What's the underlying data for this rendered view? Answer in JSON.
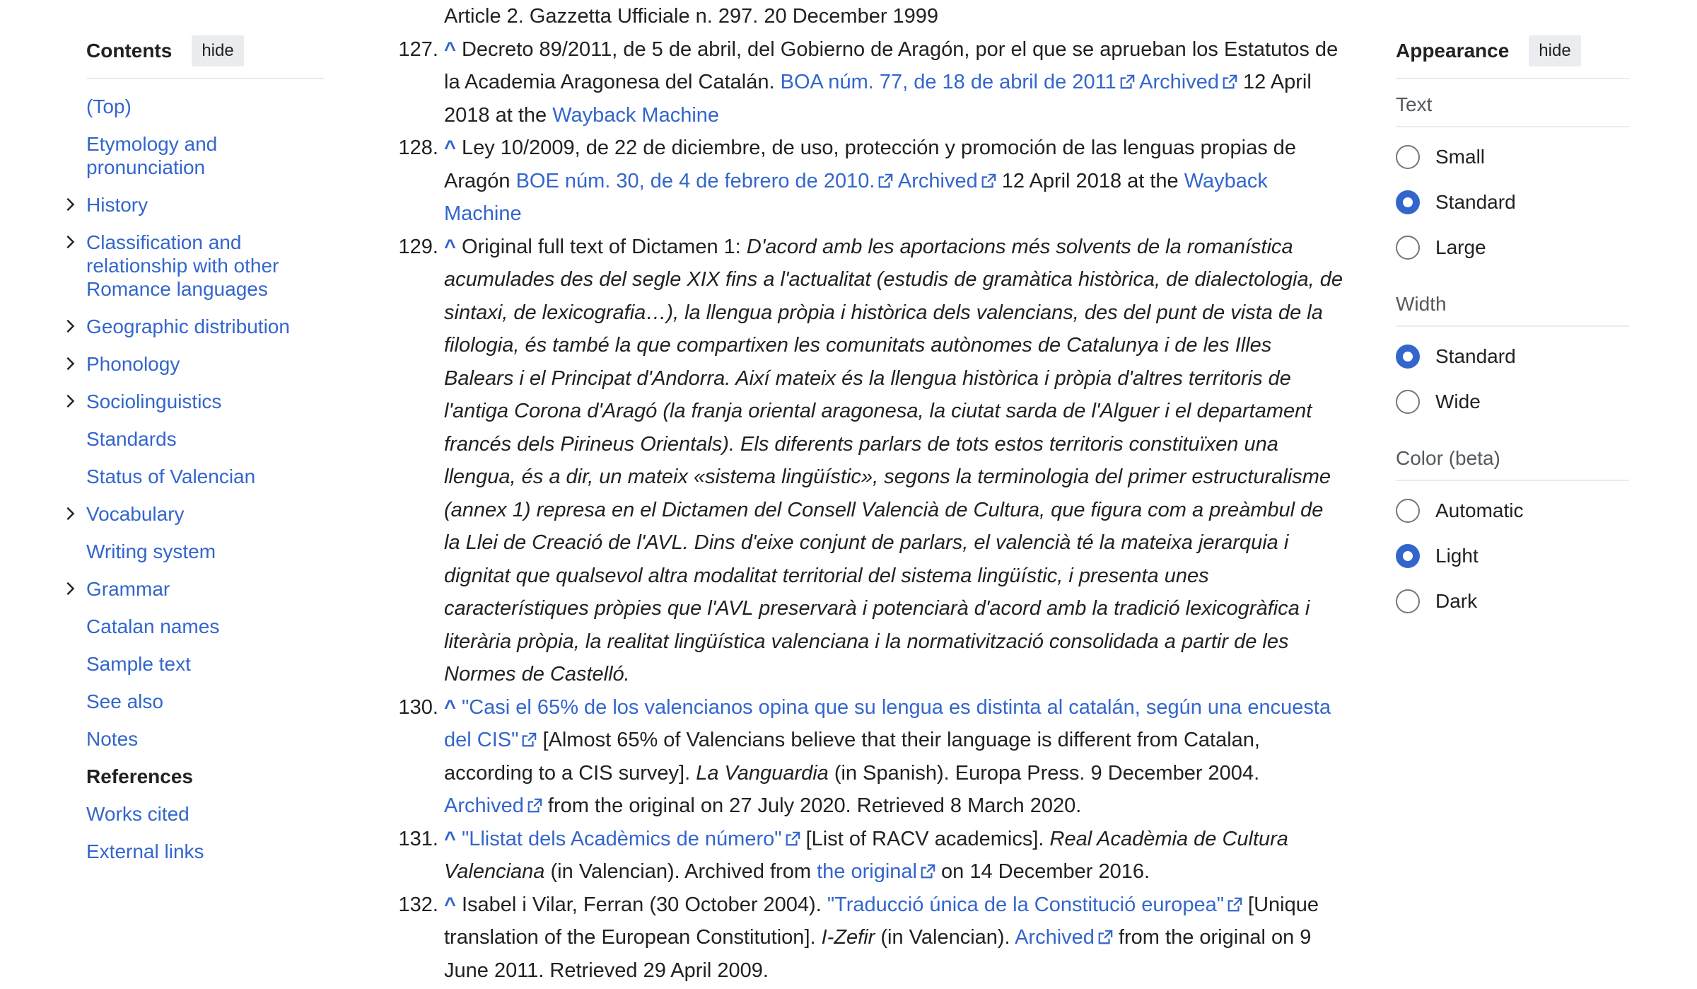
{
  "toc": {
    "title": "Contents",
    "hide_label": "hide",
    "items": [
      {
        "label": "(Top)",
        "expandable": false,
        "active": false
      },
      {
        "label": "Etymology and pronunciation",
        "expandable": false,
        "active": false
      },
      {
        "label": "History",
        "expandable": true,
        "active": false
      },
      {
        "label": "Classification and relationship with other Romance languages",
        "expandable": true,
        "active": false
      },
      {
        "label": "Geographic distribution",
        "expandable": true,
        "active": false
      },
      {
        "label": "Phonology",
        "expandable": true,
        "active": false
      },
      {
        "label": "Sociolinguistics",
        "expandable": true,
        "active": false
      },
      {
        "label": "Standards",
        "expandable": false,
        "active": false
      },
      {
        "label": "Status of Valencian",
        "expandable": false,
        "active": false
      },
      {
        "label": "Vocabulary",
        "expandable": true,
        "active": false
      },
      {
        "label": "Writing system",
        "expandable": false,
        "active": false
      },
      {
        "label": "Grammar",
        "expandable": true,
        "active": false
      },
      {
        "label": "Catalan names",
        "expandable": false,
        "active": false
      },
      {
        "label": "Sample text",
        "expandable": false,
        "active": false
      },
      {
        "label": "See also",
        "expandable": false,
        "active": false
      },
      {
        "label": "Notes",
        "expandable": false,
        "active": false
      },
      {
        "label": "References",
        "expandable": false,
        "active": true
      },
      {
        "label": "Works cited",
        "expandable": false,
        "active": false
      },
      {
        "label": "External links",
        "expandable": false,
        "active": false
      }
    ]
  },
  "references": {
    "top_fragment": "Article 2. Gazzetta Ufficiale n. 297. 20 December 1999",
    "r127": {
      "num": "127.",
      "caret": "^",
      "t1": "Decreto 89/2011, de 5 de abril, del Gobierno de Aragón, por el que se aprueban los Estatutos de la Academia Aragonesa del Catalán. ",
      "link1": "BOA núm. 77, de 18 de abril de 2011",
      "link2": "Archived",
      "t2": " 12 April 2018 at the ",
      "link3": "Wayback Machine"
    },
    "r128": {
      "num": "128.",
      "caret": "^",
      "t1": "Ley 10/2009, de 22 de diciembre, de uso, protección y promoción de las lenguas propias de Aragón ",
      "link1": "BOE núm. 30, de 4 de febrero de 2010.",
      "link2": "Archived",
      "t2": " 12 April 2018 at the ",
      "link3": "Wayback Machine"
    },
    "r129": {
      "num": "129.",
      "caret": "^",
      "t1": "Original full text of Dictamen 1: ",
      "italic": "D'acord amb les aportacions més solvents de la romanística acumulades des del segle XIX fins a l'actualitat (estudis de gramàtica històrica, de dialectologia, de sintaxi, de lexicografia…), la llengua pròpia i històrica dels valencians, des del punt de vista de la filologia, és també la que compartixen les comunitats autònomes de Catalunya i de les Illes Balears i el Principat d'Andorra. Així mateix és la llengua històrica i pròpia d'altres territoris de l'antiga Corona d'Aragó (la franja oriental aragonesa, la ciutat sarda de l'Alguer i el departament francés dels Pirineus Orientals). Els diferents parlars de tots estos territoris constituïxen una llengua, és a dir, un mateix «sistema lingüístic», segons la terminologia del primer estructuralisme (annex 1) represa en el Dictamen del Consell Valencià de Cultura, que figura com a preàmbul de la Llei de Creació de l'AVL. Dins d'eixe conjunt de parlars, el valencià té la mateixa jerarquia i dignitat que qualsevol altra modalitat territorial del sistema lingüístic, i presenta unes característiques pròpies que l'AVL preservarà i potenciarà d'acord amb la tradició lexicogràfica i literària pròpia, la realitat lingüística valenciana i la normativització consolidada a partir de les Normes de Castelló."
    },
    "r130": {
      "num": "130.",
      "caret": "^",
      "link1": "\"Casi el 65% de los valencianos opina que su lengua es distinta al catalán, según una encuesta del CIS\"",
      "t1": " [Almost 65% of Valencians believe that their language is different from Catalan, according to a CIS survey]. ",
      "italic": "La Vanguardia",
      "t2": " (in Spanish). Europa Press. 9 December 2004. ",
      "link2": "Archived",
      "t3": " from the original on 27 July 2020. Retrieved 8 March 2020."
    },
    "r131": {
      "num": "131.",
      "caret": "^",
      "link1": "\"Llistat dels Acadèmics de número\"",
      "t1": " [List of RACV academics]. ",
      "italic": "Real Acadèmia de Cultura Valenciana",
      "t2": " (in Valencian). Archived from ",
      "link2": "the original",
      "t3": " on 14 December 2016."
    },
    "r132": {
      "num": "132.",
      "caret": "^",
      "t1": "Isabel i Vilar, Ferran (30 October 2004). ",
      "link1": "\"Traducció única de la Constitució europea\"",
      "t2": " [Unique translation of the European Constitution]. ",
      "italic": "I-Zefir",
      "t3": " (in Valencian). ",
      "link2": "Archived",
      "t4": " from the original on 9 June 2011. Retrieved 29 April 2009."
    }
  },
  "appearance": {
    "title": "Appearance",
    "hide_label": "hide",
    "text": {
      "label": "Text",
      "options": [
        {
          "label": "Small",
          "checked": false
        },
        {
          "label": "Standard",
          "checked": true
        },
        {
          "label": "Large",
          "checked": false
        }
      ]
    },
    "width": {
      "label": "Width",
      "options": [
        {
          "label": "Standard",
          "checked": true
        },
        {
          "label": "Wide",
          "checked": false
        }
      ]
    },
    "color": {
      "label": "Color (beta)",
      "options": [
        {
          "label": "Automatic",
          "checked": false
        },
        {
          "label": "Light",
          "checked": true
        },
        {
          "label": "Dark",
          "checked": false
        }
      ]
    }
  },
  "colors": {
    "link": "#3366cc",
    "text": "#202122",
    "muted": "#54595d",
    "divider": "#eaecf0",
    "button_bg": "#eaecf0"
  }
}
